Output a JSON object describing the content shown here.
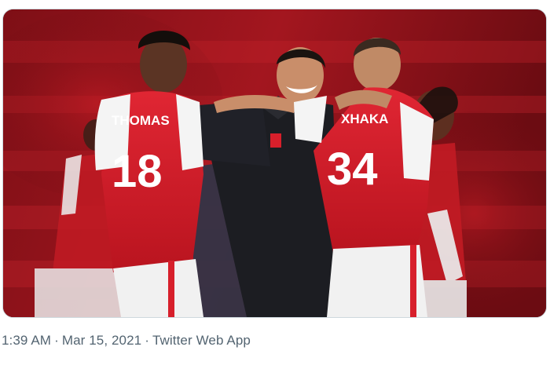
{
  "tweet": {
    "media": {
      "jersey_names": [
        "THOMAS",
        "XHAKA"
      ],
      "jersey_numbers": [
        "18",
        "34"
      ],
      "colors": {
        "arsenal_red": "#d71f2b",
        "sleeve_white": "#f4f4f4",
        "staff_black": "#1c1d22",
        "background_red": "#8f1219"
      }
    },
    "meta": {
      "time": "1:39 AM",
      "separator": "·",
      "date": "Mar 15, 2021",
      "source": "Twitter Web App"
    }
  }
}
